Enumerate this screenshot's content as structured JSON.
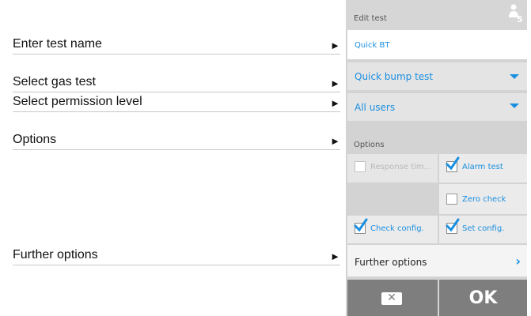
{
  "annotations": [
    {
      "label": "Enter test name",
      "arrow": "►"
    },
    {
      "label": "Select gas test",
      "arrow": "►"
    },
    {
      "label": "Select permission level",
      "arrow": "►"
    },
    {
      "label": "Options",
      "arrow": "►"
    },
    {
      "label": "Further options",
      "arrow": "►"
    }
  ],
  "device": {
    "header": {
      "title": "Edit test",
      "user_level": "5"
    },
    "test_name": {
      "value": "Quick BT"
    },
    "gas_test": {
      "selected": "Quick bump test"
    },
    "permission": {
      "selected": "All users"
    },
    "options": {
      "label": "Options",
      "response_time": {
        "label": "Response tim...",
        "checked": false,
        "enabled": false
      },
      "alarm_test": {
        "label": "Alarm test",
        "checked": true
      },
      "zero_check": {
        "label": "Zero check",
        "checked": false
      },
      "check_config": {
        "label": "Check config.",
        "checked": true
      },
      "set_config": {
        "label": "Set config.",
        "checked": true
      }
    },
    "further_options": {
      "label": "Further options",
      "chevron": "›"
    },
    "buttons": {
      "cancel": "✕",
      "ok": "OK"
    }
  },
  "colors": {
    "accent": "#1a8fe0",
    "panel": "#d3d3d3",
    "button": "#7e7e7e"
  }
}
